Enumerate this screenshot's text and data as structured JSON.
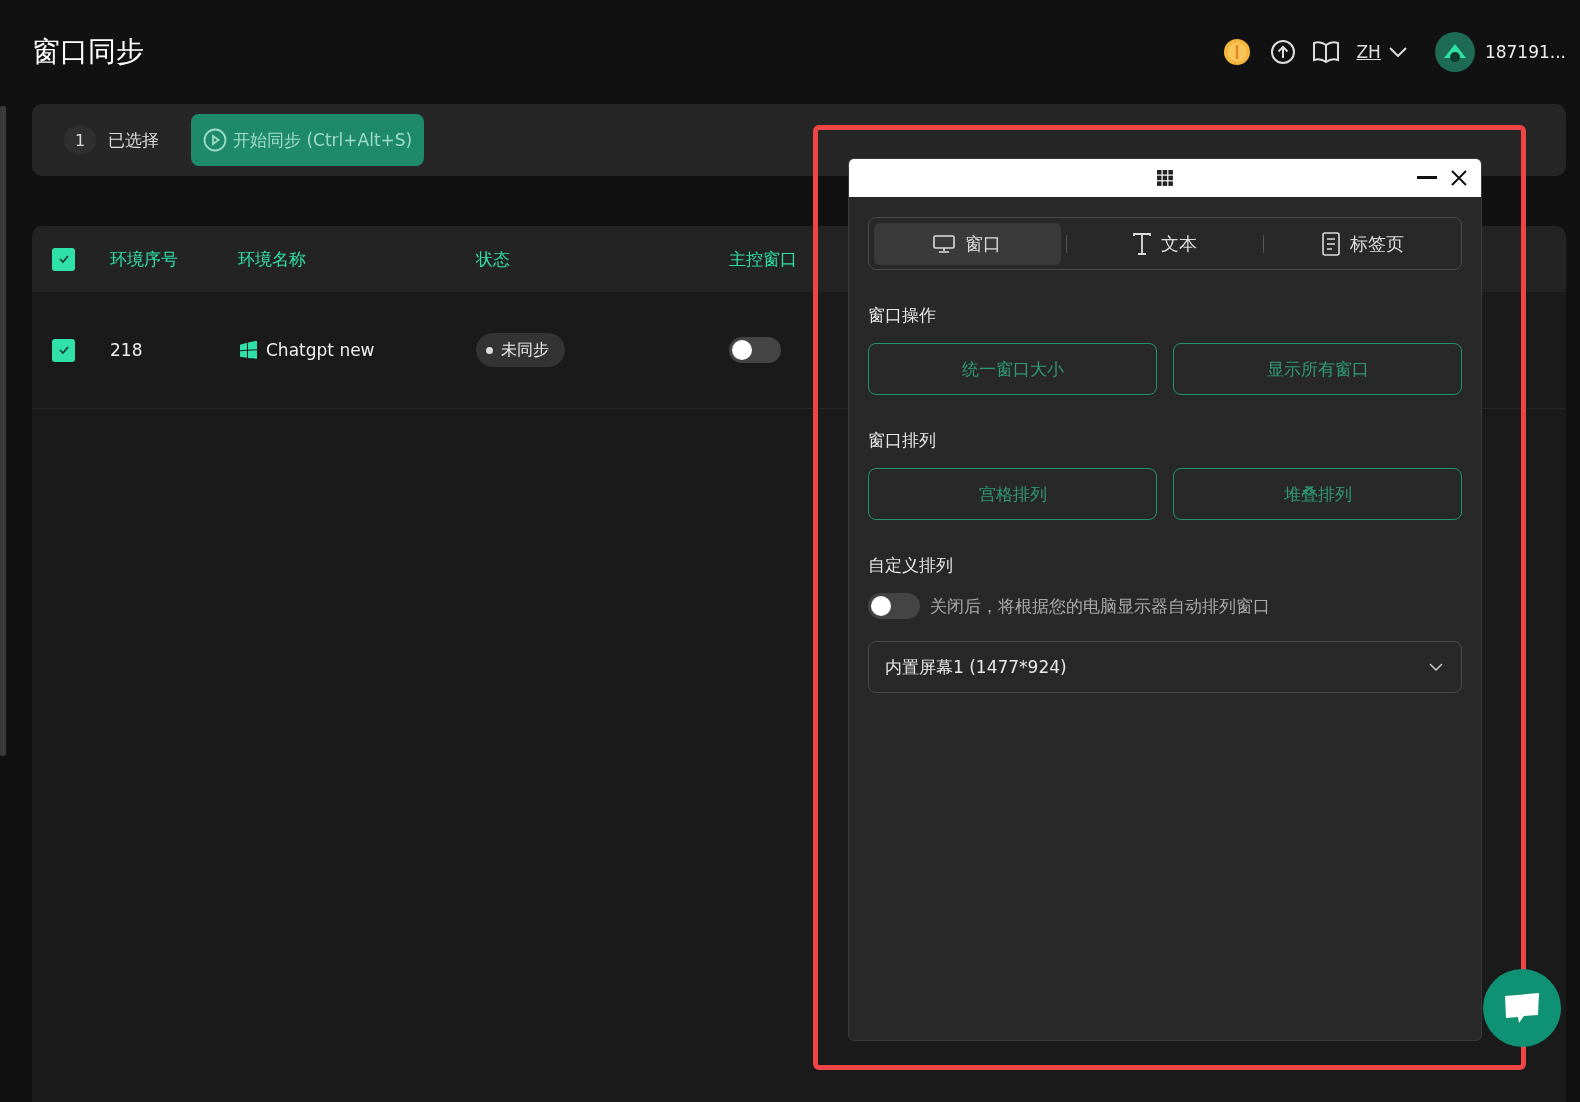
{
  "page": {
    "title": "窗口同步"
  },
  "header": {
    "language": "ZH",
    "username": "187191..."
  },
  "toolbar": {
    "selected_count": "1",
    "selected_label": "已选择",
    "sync_button": {
      "label": "开始同步 (Ctrl+Alt+S)",
      "disabled": true
    }
  },
  "table": {
    "all_checked": true,
    "columns": [
      "环境序号",
      "环境名称",
      "状态",
      "主控窗口"
    ],
    "rows": [
      {
        "checked": true,
        "number": "218",
        "name": "Chatgpt new",
        "status": "未同步",
        "master_on": false
      }
    ]
  },
  "sync_panel": {
    "tabs": [
      {
        "kind": "monitor",
        "label": "窗口",
        "selected": true
      },
      {
        "kind": "text",
        "label": "文本",
        "selected": false
      },
      {
        "kind": "document",
        "label": "标签页",
        "selected": false
      }
    ],
    "sections": [
      {
        "title": "窗口操作",
        "buttons": [
          "统一窗口大小",
          "显示所有窗口"
        ]
      },
      {
        "title": "窗口排列",
        "buttons": [
          "宫格排列",
          "堆叠排列"
        ]
      }
    ],
    "custom": {
      "title": "自定义排列",
      "toggle_on": false,
      "hint": "关闭后，将根据您的电脑显示器自动排列窗口",
      "screen_select": "内置屏幕1 (1477*924)"
    }
  }
}
